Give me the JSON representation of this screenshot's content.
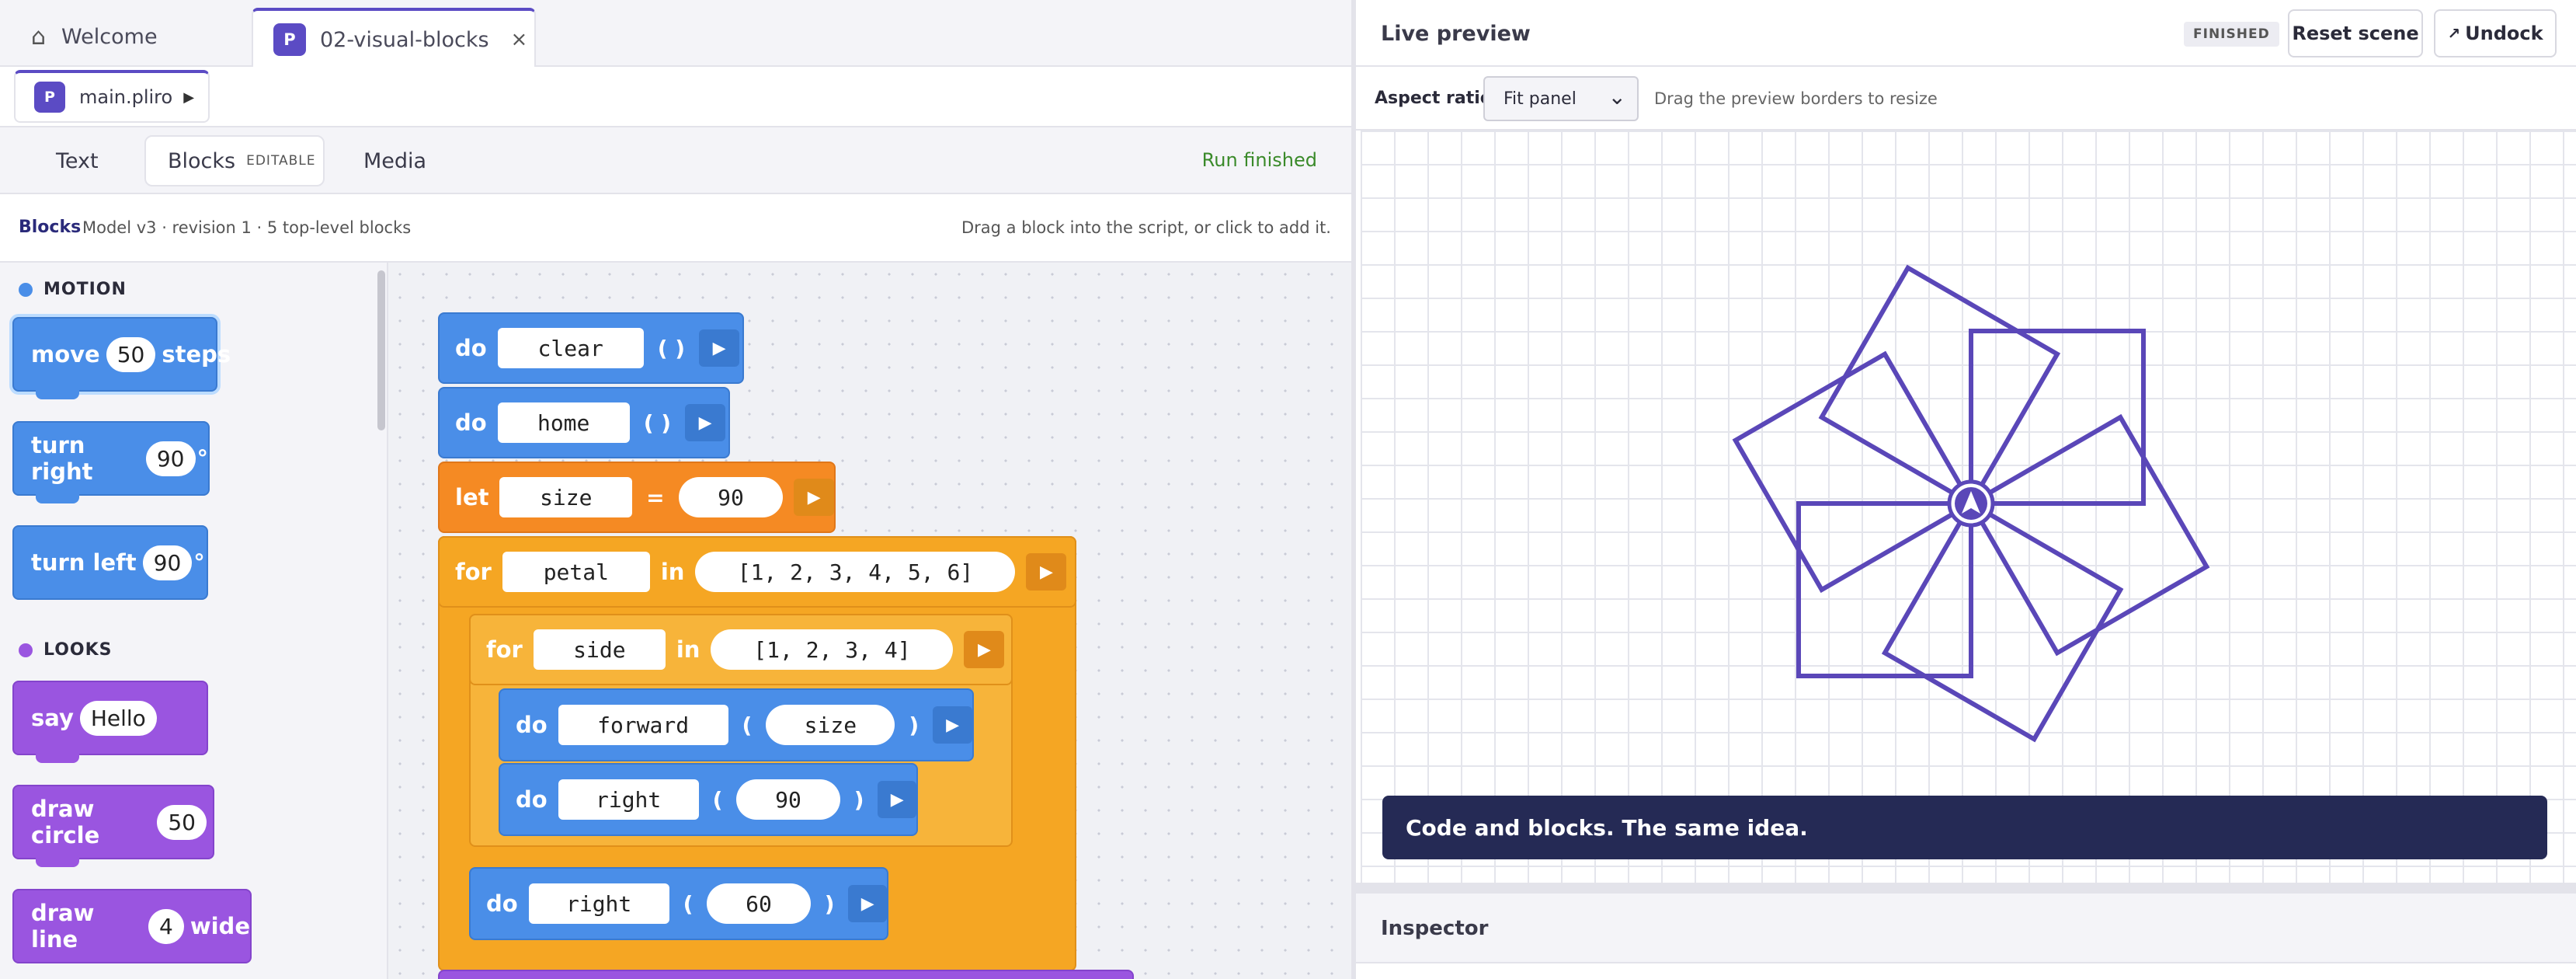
{
  "tabs": [
    {
      "label": "Welcome",
      "icon": "home-icon"
    },
    {
      "label": "02-visual-blocks",
      "badge": "P",
      "icon": "close-icon"
    }
  ],
  "file_tab": {
    "badge": "P",
    "label": "main.pliro",
    "icon": "play-icon"
  },
  "modes": {
    "text": "Text",
    "blocks": "Blocks",
    "blocks_tag": "EDITABLE",
    "media": "Media"
  },
  "run_status": "Run finished",
  "info": {
    "label": "Blocks",
    "meta": "Model v3 · revision 1 · 5 top-level blocks",
    "hint": "Drag a block into the script, or click to add it."
  },
  "palette": {
    "motion_label": "MOTION",
    "motion_color": "#4a8ee8",
    "looks_label": "LOOKS",
    "looks_color": "#9a55e0",
    "move": {
      "pre": "move",
      "value": "50",
      "post": "steps"
    },
    "turn_right": {
      "pre": "turn right",
      "value": "90",
      "post": "°"
    },
    "turn_left": {
      "pre": "turn left",
      "value": "90",
      "post": "°"
    },
    "say": {
      "pre": "say",
      "value": "Hello"
    },
    "draw_circle": {
      "pre": "draw circle",
      "value": "50"
    },
    "draw_line": {
      "pre": "draw line",
      "value": "4",
      "post": "wide"
    }
  },
  "script": {
    "b1": {
      "kw": "do",
      "name": "clear",
      "args": "( )"
    },
    "b2": {
      "kw": "do",
      "name": "home",
      "args": "( )"
    },
    "b3": {
      "kw": "let",
      "name": "size",
      "op": "=",
      "value": "90"
    },
    "b4": {
      "kw": "for",
      "var": "petal",
      "in": "in",
      "list": "[1, 2, 3, 4, 5, 6]"
    },
    "b5": {
      "kw": "for",
      "var": "side",
      "in": "in",
      "list": "[1, 2, 3, 4]"
    },
    "b6": {
      "kw": "do",
      "name": "forward",
      "lp": "(",
      "arg": "size",
      "rp": ")"
    },
    "b7": {
      "kw": "do",
      "name": "right",
      "lp": "(",
      "arg": "90",
      "rp": ")"
    },
    "b8": {
      "kw": "do",
      "name": "right",
      "lp": "(",
      "arg": "60",
      "rp": ")"
    }
  },
  "preview": {
    "title": "Live preview",
    "status": "FINISHED",
    "reset": "Reset scene",
    "undock": "Undock",
    "undock_icon": "external-arrow-icon",
    "aspect_label": "Aspect ratio",
    "aspect_value": "Fit panel",
    "aspect_hint": "Drag the preview borders to resize",
    "toast": "Code and blocks. The same idea.",
    "stroke_color": "#5a47b8"
  },
  "inspector": {
    "title": "Inspector"
  }
}
